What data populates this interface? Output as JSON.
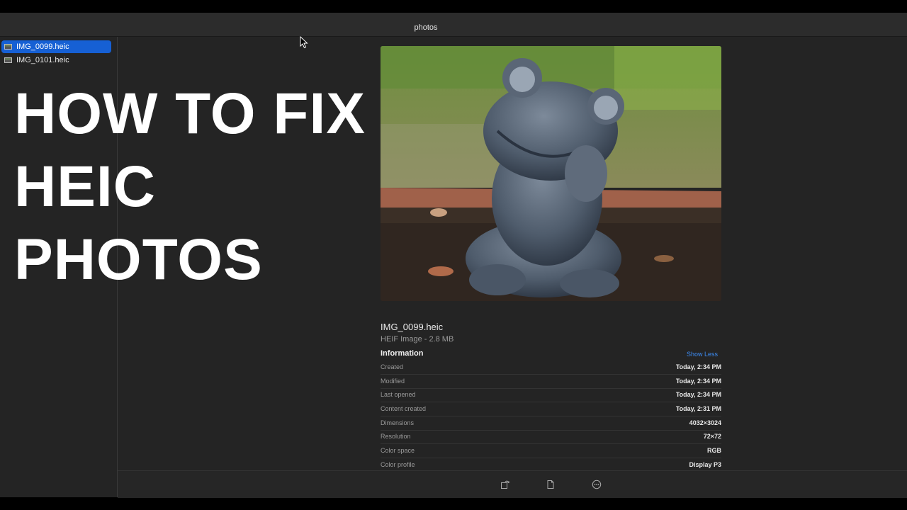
{
  "window": {
    "title": "photos"
  },
  "sidebar": {
    "items": [
      {
        "label": "IMG_0099.heic",
        "selected": true,
        "icon": "image-file-icon"
      },
      {
        "label": "IMG_0101.heic",
        "selected": false,
        "icon": "image-file-icon"
      }
    ]
  },
  "overlay": {
    "lines": [
      "HOW TO FIX",
      "HEIC",
      "PHOTOS"
    ]
  },
  "preview": {
    "image": "frog-statue-photo"
  },
  "info": {
    "file_name": "IMG_0099.heic",
    "file_type": "HEIF Image - 2.8 MB",
    "section_title": "Information",
    "toggle_label": "Show Less",
    "rows": [
      {
        "key": "Created",
        "value": "Today, 2:34 PM"
      },
      {
        "key": "Modified",
        "value": "Today, 2:34 PM"
      },
      {
        "key": "Last opened",
        "value": "Today, 2:34 PM"
      },
      {
        "key": "Content created",
        "value": "Today, 2:31 PM"
      },
      {
        "key": "Dimensions",
        "value": "4032×3024"
      },
      {
        "key": "Resolution",
        "value": "72×72"
      },
      {
        "key": "Color space",
        "value": "RGB"
      },
      {
        "key": "Color profile",
        "value": "Display P3"
      }
    ]
  },
  "toolbar": {
    "icons": [
      "rotate-icon",
      "document-icon",
      "more-icon"
    ]
  },
  "colors": {
    "accent": "#1660d4",
    "link": "#3d8df5",
    "background": "#242424"
  }
}
